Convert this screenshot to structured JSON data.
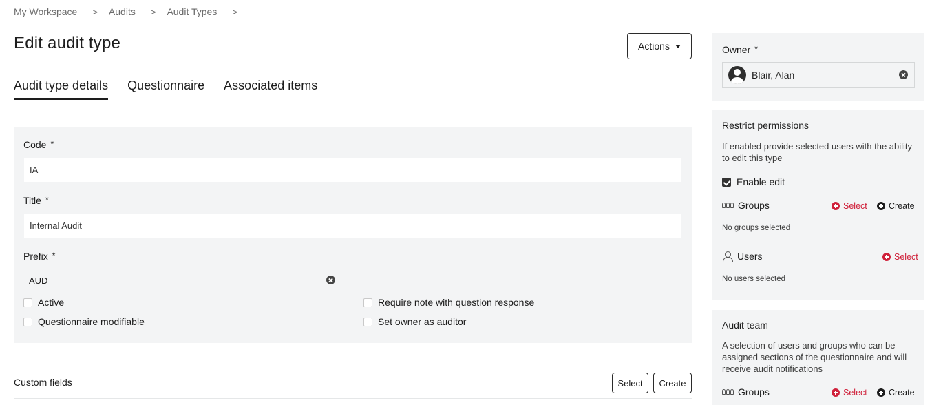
{
  "breadcrumb": {
    "items": [
      "My Workspace",
      "Audits",
      "Audit Types"
    ],
    "separator": ">"
  },
  "page": {
    "title": "Edit audit type",
    "actions_label": "Actions"
  },
  "tabs": [
    {
      "label": "Audit type details",
      "active": true
    },
    {
      "label": "Questionnaire",
      "active": false
    },
    {
      "label": "Associated items",
      "active": false
    }
  ],
  "form": {
    "code_label": "Code",
    "code_value": "IA",
    "title_label": "Title",
    "title_value": "Internal Audit",
    "prefix_label": "Prefix",
    "prefix_value": "AUD",
    "required_mark": "*",
    "checkboxes": {
      "active": {
        "label": "Active",
        "checked": false
      },
      "questionnaire_modifiable": {
        "label": "Questionnaire modifiable",
        "checked": false
      },
      "require_note": {
        "label": "Require note with question response",
        "checked": false
      },
      "set_owner_auditor": {
        "label": "Set owner as auditor",
        "checked": false
      }
    }
  },
  "custom_fields": {
    "title": "Custom fields",
    "select_label": "Select",
    "create_label": "Create"
  },
  "owner": {
    "label": "Owner",
    "value": "Blair, Alan"
  },
  "restrict": {
    "title": "Restrict permissions",
    "description": "If enabled provide selected users with the ability to edit this type",
    "enable_edit_label": "Enable edit",
    "enable_edit_checked": true,
    "groups_label": "Groups",
    "groups_empty": "No groups selected",
    "users_label": "Users",
    "users_empty": "No users selected",
    "select_label": "Select",
    "create_label": "Create"
  },
  "audit_team": {
    "title": "Audit team",
    "description": "A selection of users and groups who can be assigned sections of the questionnaire and will receive audit notifications",
    "groups_label": "Groups",
    "select_label": "Select",
    "create_label": "Create"
  },
  "colors": {
    "accent_red": "#d0203a",
    "panel_bg": "#f3f4f5",
    "text": "#1d1d1d"
  }
}
